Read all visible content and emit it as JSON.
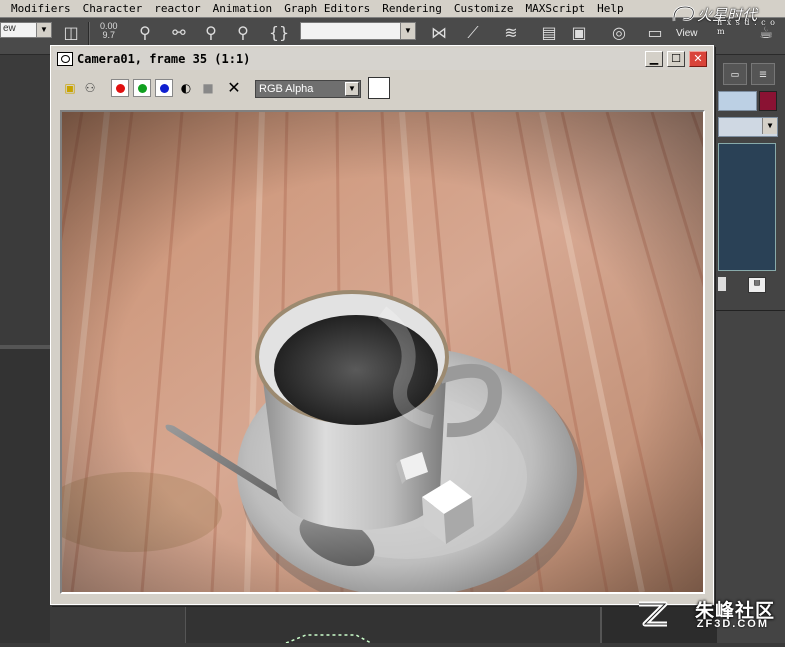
{
  "menu": {
    "items": [
      "Modifiers",
      "Character",
      "reactor",
      "Animation",
      "Graph Editors",
      "Rendering",
      "Customize",
      "MAXScript",
      "Help"
    ]
  },
  "toolbar": {
    "view_combo": "ew",
    "snap_label": "0.00\n9.7",
    "right_view_label": "View",
    "empty_combo": ""
  },
  "brand": {
    "logo_text": "火星时代",
    "logo_sub": "h x s d . c o m"
  },
  "render_window": {
    "title": "Camera01, frame 35 (1:1)",
    "channel_select": "RGB Alpha",
    "channel_options": [
      "RGB Alpha"
    ],
    "swatch_color": "#ffffff",
    "tools": {
      "save_icon": "save-icon",
      "clone_icon": "clone-icon",
      "red_channel": "#e01010",
      "green_channel": "#10a020",
      "blue_channel": "#1020d0",
      "mono_icon": "mono-icon",
      "clear_icon": "clear-icon"
    }
  },
  "watermark": {
    "cn": "朱峰社区",
    "en": "ZF3D.COM"
  },
  "colors": {
    "ui_gray": "#d4d0c8",
    "max_dark": "#3a3a3a",
    "close_red": "#d9443b",
    "wood": "#c58a6a"
  }
}
